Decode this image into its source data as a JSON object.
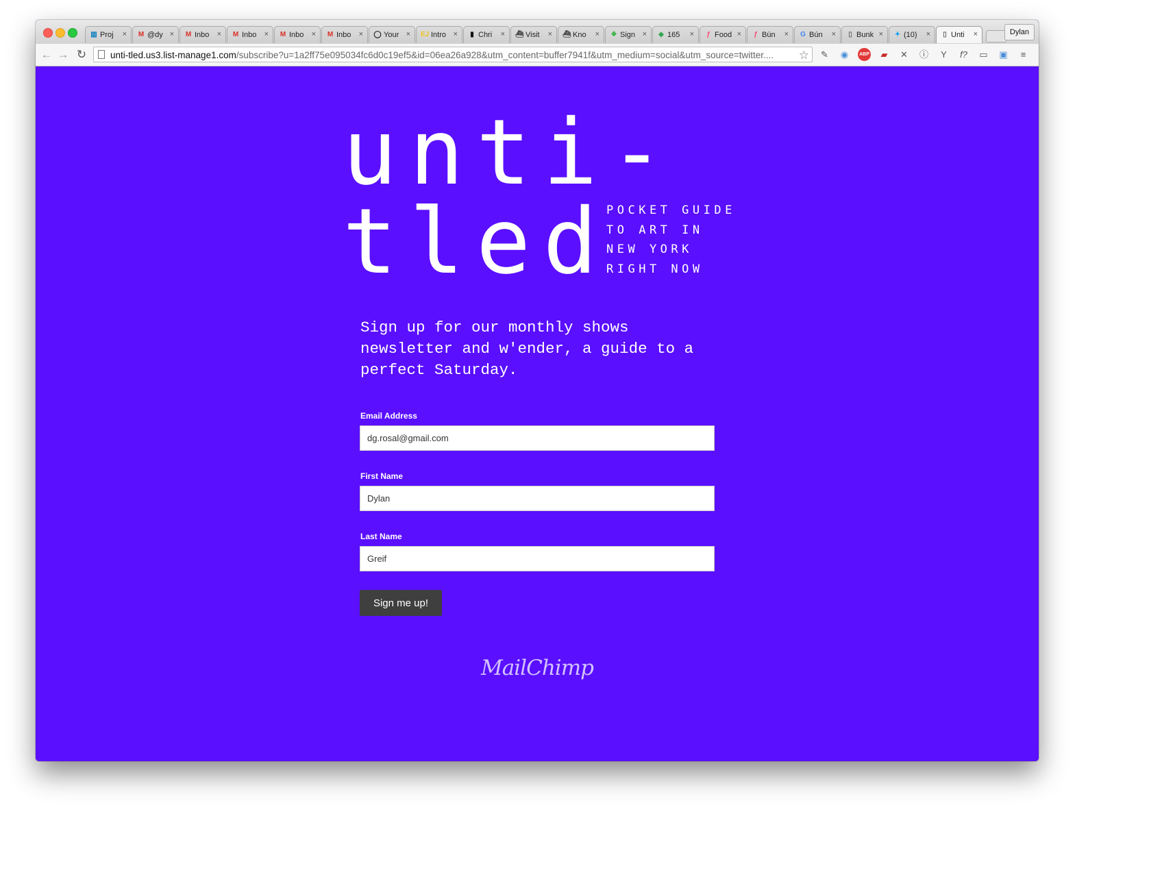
{
  "browser": {
    "tabs": [
      {
        "title": "Proj",
        "icon": "trello-icon",
        "color": "#0079bf"
      },
      {
        "title": "@dy",
        "icon": "gmail-icon",
        "color": "#d93025"
      },
      {
        "title": "Inbo",
        "icon": "gmail-icon",
        "color": "#d93025"
      },
      {
        "title": "Inbo",
        "icon": "gmail-icon",
        "color": "#d93025"
      },
      {
        "title": "Inbo",
        "icon": "gmail-icon",
        "color": "#d93025"
      },
      {
        "title": "Inbo",
        "icon": "gmail-icon",
        "color": "#d93025"
      },
      {
        "title": "Your",
        "icon": "ring-icon",
        "color": "#111111"
      },
      {
        "title": "Intro",
        "icon": "ejs-icon",
        "color": "#f5c518"
      },
      {
        "title": "Chri",
        "icon": "page-icon",
        "color": "#111111"
      },
      {
        "title": "Visit",
        "icon": "boat-icon",
        "color": "#444444"
      },
      {
        "title": "Kno",
        "icon": "boat-icon",
        "color": "#444444"
      },
      {
        "title": "Sign",
        "icon": "leaf-icon",
        "color": "#3ab54a"
      },
      {
        "title": "165",
        "icon": "maps-icon",
        "color": "#34a853"
      },
      {
        "title": "Food",
        "icon": "foursquare-icon",
        "color": "#f94877"
      },
      {
        "title": "Bún",
        "icon": "foursquare-icon",
        "color": "#f94877"
      },
      {
        "title": "Bún",
        "icon": "google-icon",
        "color": "#4285f4"
      },
      {
        "title": "Bunk",
        "icon": "doc-icon",
        "color": "#666666"
      },
      {
        "title": "(10)",
        "icon": "twitter-icon",
        "color": "#1da1f2"
      },
      {
        "title": "Unti",
        "icon": "doc-icon",
        "color": "#666666",
        "active": true
      }
    ],
    "profile": "Dylan",
    "url_host": "unti-tled.us3.list-manage1.com",
    "url_path": "/subscribe?u=1a2ff75e095034fc6d0c19ef5&id=06ea26a928&utm_content=buffer7941f&utm_medium=social&utm_source=twitter...."
  },
  "brand": {
    "line1": "unti-",
    "line2": "tled",
    "tagline": [
      "POCKET GUIDE",
      "TO ART IN",
      "NEW YORK",
      "RIGHT NOW"
    ],
    "background": "#5a0fff"
  },
  "intro": "Sign up for our monthly shows newsletter and w'ender, a guide to a perfect Saturday.",
  "form": {
    "email_label": "Email Address",
    "email_value": "dg.rosal@gmail.com",
    "first_label": "First Name",
    "first_value": "Dylan",
    "last_label": "Last Name",
    "last_value": "Greif",
    "submit_label": "Sign me up!"
  },
  "footer": {
    "provider": "MailChimp"
  }
}
